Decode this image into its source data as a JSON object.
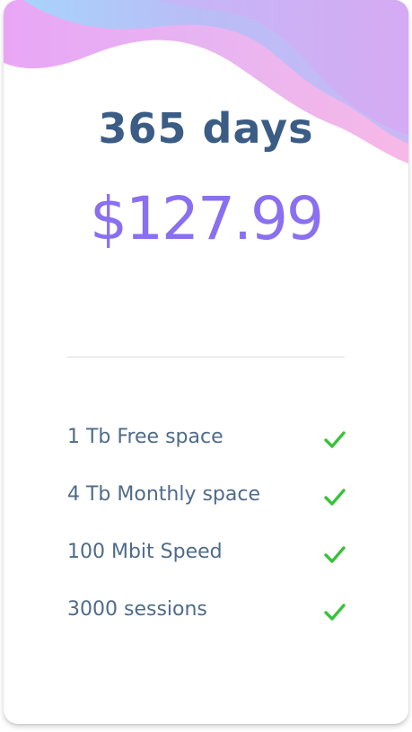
{
  "plan": {
    "duration": "365 days",
    "price": "$127.99"
  },
  "features": [
    {
      "label": "1 Tb Free space",
      "icon": "check-icon"
    },
    {
      "label": "4 Tb Monthly space",
      "icon": "check-icon"
    },
    {
      "label": "100 Mbit Speed",
      "icon": "check-icon"
    },
    {
      "label": "3000 sessions",
      "icon": "check-icon"
    }
  ],
  "colors": {
    "title": "#3b5c84",
    "price": "#8a6ff0",
    "feature_text": "#4f6b8a",
    "check": "#3ac23a",
    "wave_pink": "#f4b6ec",
    "wave_blue": "#a9c6f7",
    "wave_purple": "#d3a9f3"
  }
}
